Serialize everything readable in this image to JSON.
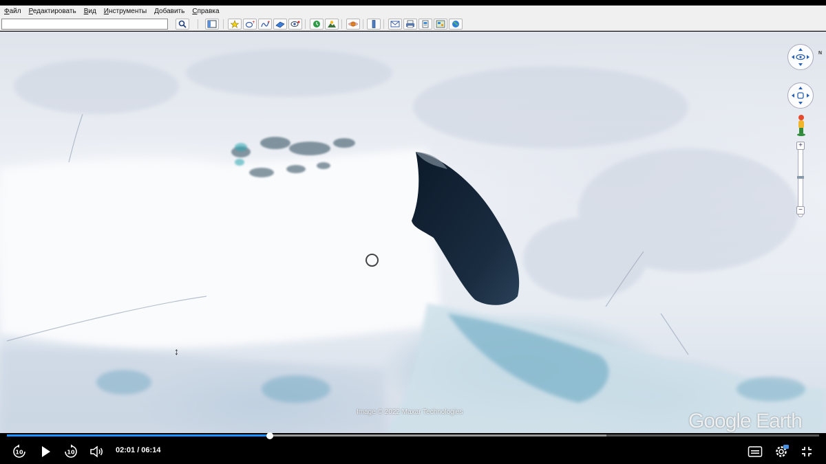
{
  "menu": {
    "items": [
      "Файл",
      "Редактировать",
      "Вид",
      "Инструменты",
      "Добавить",
      "Справка"
    ]
  },
  "toolbar": {
    "search_value": "",
    "icons": [
      "search-icon",
      "sidebar-toggle-icon",
      "placemark-icon",
      "polygon-icon",
      "path-icon",
      "image-overlay-icon",
      "tour-record-icon",
      "historical-imagery-icon",
      "sunlight-icon",
      "planets-icon",
      "ruler-icon",
      "email-icon",
      "print-icon",
      "save-image-icon",
      "view-in-maps-icon",
      "earth-icon"
    ]
  },
  "map": {
    "imagery_credit": "Image © 2022 Maxar Technologies",
    "watermark": "Google Earth",
    "north_label": "N"
  },
  "player": {
    "current_time": "02:01",
    "duration": "06:14",
    "time_display": "02:01 / 06:14",
    "progress_fraction": 0.324,
    "buffered_fraction": 0.738,
    "skip_back_label": "10",
    "skip_forward_label": "10"
  },
  "colors": {
    "progress": "#1e90ff",
    "toolbar_bg": "#f0f0f0"
  }
}
